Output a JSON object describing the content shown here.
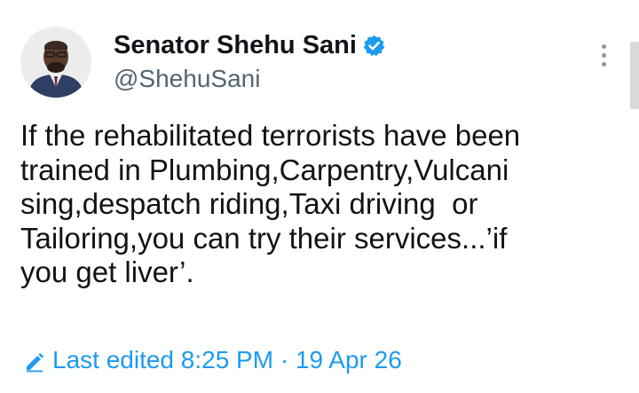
{
  "author": {
    "name": "Senator Shehu Sani",
    "handle": "@ShehuSani",
    "verified": true,
    "verified_color": "#1d9bf0"
  },
  "post": {
    "text_lines": [
      "If the rehabilitated terrorists have been",
      "trained in Plumbing,Carpentry,Vulcani",
      "sing,despatch riding,Taxi driving  or",
      "Tailoring,you can try their services...’if",
      "you get liver’."
    ]
  },
  "edit_info": {
    "label": "Last edited 8:25 PM · 19 Apr 26",
    "icon": "pencil-icon",
    "color": "#1d9bf0"
  },
  "menu": {
    "icon": "more-vertical-icon"
  }
}
